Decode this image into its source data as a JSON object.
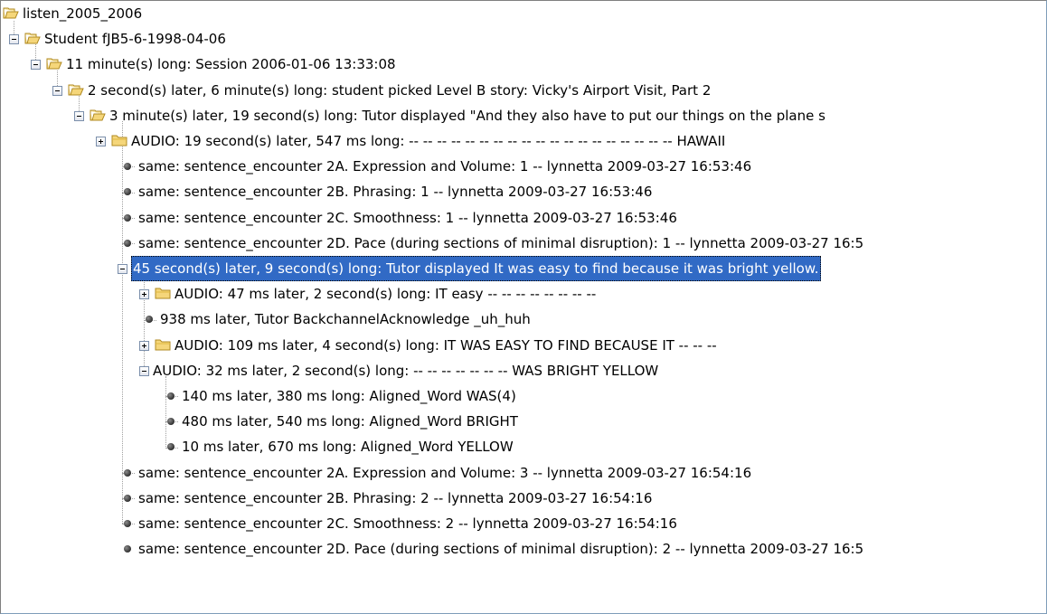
{
  "tree": {
    "root": {
      "label": "listen_2005_2006"
    },
    "student": {
      "label": "Student fJB5-6-1998-04-06"
    },
    "session": {
      "label": "11 minute(s) long:  Session 2006-01-06 13:33:08"
    },
    "story": {
      "label": "2 second(s) later, 6 minute(s) long:  student picked Level B story:  Vicky's Airport Visit, Part 2"
    },
    "sentence1": {
      "label": "3 minute(s) later, 19 second(s) long:  Tutor displayed  \"And they also have to put our things on the plane s",
      "audio": "AUDIO: 19 second(s) later, 547 ms long:  -- -- -- -- -- -- -- -- -- -- -- -- -- -- -- -- -- -- -- HAWAII"
    },
    "encounter1": [
      "same: sentence_encounter 2A. Expression and Volume: 1 -- lynnetta 2009-03-27 16:53:46",
      "same: sentence_encounter 2B. Phrasing: 1 -- lynnetta 2009-03-27 16:53:46",
      "same: sentence_encounter 2C. Smoothness: 1 -- lynnetta 2009-03-27 16:53:46",
      "same: sentence_encounter 2D. Pace (during sections of minimal disruption): 1 -- lynnetta 2009-03-27 16:5"
    ],
    "sentence2": {
      "label": "45 second(s) later, 9 second(s) long:  Tutor displayed  It was easy to find because it was bright yellow.",
      "audio1": "AUDIO: 47 ms later, 2 second(s) long:  IT easy -- -- -- -- -- -- -- --",
      "backchannel": "938 ms later, Tutor BackchannelAcknowledge _uh_huh",
      "audio2": "AUDIO: 109 ms later, 4 second(s) long:  IT WAS EASY TO FIND BECAUSE IT -- -- --",
      "audio3": "AUDIO: 32 ms later, 2 second(s) long:  -- -- -- -- -- -- -- WAS BRIGHT YELLOW",
      "words": [
        "140 ms later, 380 ms long:  Aligned_Word WAS(4)",
        "480 ms later, 540 ms long:  Aligned_Word BRIGHT",
        "10 ms later, 670 ms long:  Aligned_Word YELLOW"
      ]
    },
    "encounter2": [
      "same: sentence_encounter 2A. Expression and Volume: 3 -- lynnetta 2009-03-27 16:54:16",
      "same: sentence_encounter 2B. Phrasing: 2 -- lynnetta 2009-03-27 16:54:16",
      "same: sentence_encounter 2C. Smoothness: 2 -- lynnetta 2009-03-27 16:54:16",
      "same: sentence_encounter 2D. Pace (during sections of minimal disruption): 2 -- lynnetta 2009-03-27 16:5"
    ]
  },
  "colors": {
    "selection": "#316ac5",
    "folder": "#f5d67a",
    "tree_lines": "#a0a0a0"
  }
}
